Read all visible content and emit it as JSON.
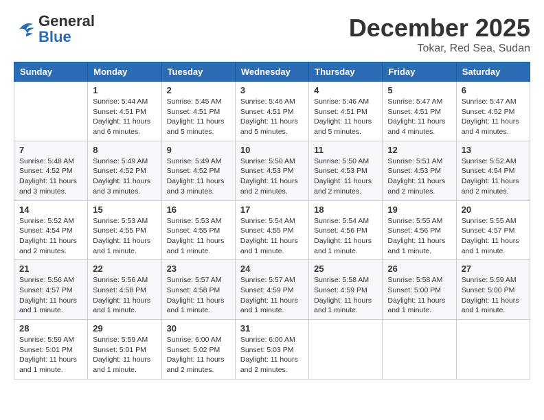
{
  "header": {
    "logo_general": "General",
    "logo_blue": "Blue",
    "month": "December 2025",
    "location": "Tokar, Red Sea, Sudan"
  },
  "days_of_week": [
    "Sunday",
    "Monday",
    "Tuesday",
    "Wednesday",
    "Thursday",
    "Friday",
    "Saturday"
  ],
  "weeks": [
    [
      {
        "day": null,
        "info": ""
      },
      {
        "day": "1",
        "sunrise": "5:44 AM",
        "sunset": "4:51 PM",
        "daylight": "11 hours and 6 minutes."
      },
      {
        "day": "2",
        "sunrise": "5:45 AM",
        "sunset": "4:51 PM",
        "daylight": "11 hours and 5 minutes."
      },
      {
        "day": "3",
        "sunrise": "5:46 AM",
        "sunset": "4:51 PM",
        "daylight": "11 hours and 5 minutes."
      },
      {
        "day": "4",
        "sunrise": "5:46 AM",
        "sunset": "4:51 PM",
        "daylight": "11 hours and 5 minutes."
      },
      {
        "day": "5",
        "sunrise": "5:47 AM",
        "sunset": "4:51 PM",
        "daylight": "11 hours and 4 minutes."
      },
      {
        "day": "6",
        "sunrise": "5:47 AM",
        "sunset": "4:52 PM",
        "daylight": "11 hours and 4 minutes."
      }
    ],
    [
      {
        "day": "7",
        "sunrise": "5:48 AM",
        "sunset": "4:52 PM",
        "daylight": "11 hours and 3 minutes."
      },
      {
        "day": "8",
        "sunrise": "5:49 AM",
        "sunset": "4:52 PM",
        "daylight": "11 hours and 3 minutes."
      },
      {
        "day": "9",
        "sunrise": "5:49 AM",
        "sunset": "4:52 PM",
        "daylight": "11 hours and 3 minutes."
      },
      {
        "day": "10",
        "sunrise": "5:50 AM",
        "sunset": "4:53 PM",
        "daylight": "11 hours and 2 minutes."
      },
      {
        "day": "11",
        "sunrise": "5:50 AM",
        "sunset": "4:53 PM",
        "daylight": "11 hours and 2 minutes."
      },
      {
        "day": "12",
        "sunrise": "5:51 AM",
        "sunset": "4:53 PM",
        "daylight": "11 hours and 2 minutes."
      },
      {
        "day": "13",
        "sunrise": "5:52 AM",
        "sunset": "4:54 PM",
        "daylight": "11 hours and 2 minutes."
      }
    ],
    [
      {
        "day": "14",
        "sunrise": "5:52 AM",
        "sunset": "4:54 PM",
        "daylight": "11 hours and 2 minutes."
      },
      {
        "day": "15",
        "sunrise": "5:53 AM",
        "sunset": "4:55 PM",
        "daylight": "11 hours and 1 minute."
      },
      {
        "day": "16",
        "sunrise": "5:53 AM",
        "sunset": "4:55 PM",
        "daylight": "11 hours and 1 minute."
      },
      {
        "day": "17",
        "sunrise": "5:54 AM",
        "sunset": "4:55 PM",
        "daylight": "11 hours and 1 minute."
      },
      {
        "day": "18",
        "sunrise": "5:54 AM",
        "sunset": "4:56 PM",
        "daylight": "11 hours and 1 minute."
      },
      {
        "day": "19",
        "sunrise": "5:55 AM",
        "sunset": "4:56 PM",
        "daylight": "11 hours and 1 minute."
      },
      {
        "day": "20",
        "sunrise": "5:55 AM",
        "sunset": "4:57 PM",
        "daylight": "11 hours and 1 minute."
      }
    ],
    [
      {
        "day": "21",
        "sunrise": "5:56 AM",
        "sunset": "4:57 PM",
        "daylight": "11 hours and 1 minute."
      },
      {
        "day": "22",
        "sunrise": "5:56 AM",
        "sunset": "4:58 PM",
        "daylight": "11 hours and 1 minute."
      },
      {
        "day": "23",
        "sunrise": "5:57 AM",
        "sunset": "4:58 PM",
        "daylight": "11 hours and 1 minute."
      },
      {
        "day": "24",
        "sunrise": "5:57 AM",
        "sunset": "4:59 PM",
        "daylight": "11 hours and 1 minute."
      },
      {
        "day": "25",
        "sunrise": "5:58 AM",
        "sunset": "4:59 PM",
        "daylight": "11 hours and 1 minute."
      },
      {
        "day": "26",
        "sunrise": "5:58 AM",
        "sunset": "5:00 PM",
        "daylight": "11 hours and 1 minute."
      },
      {
        "day": "27",
        "sunrise": "5:59 AM",
        "sunset": "5:00 PM",
        "daylight": "11 hours and 1 minute."
      }
    ],
    [
      {
        "day": "28",
        "sunrise": "5:59 AM",
        "sunset": "5:01 PM",
        "daylight": "11 hours and 1 minute."
      },
      {
        "day": "29",
        "sunrise": "5:59 AM",
        "sunset": "5:01 PM",
        "daylight": "11 hours and 1 minute."
      },
      {
        "day": "30",
        "sunrise": "6:00 AM",
        "sunset": "5:02 PM",
        "daylight": "11 hours and 2 minutes."
      },
      {
        "day": "31",
        "sunrise": "6:00 AM",
        "sunset": "5:03 PM",
        "daylight": "11 hours and 2 minutes."
      },
      {
        "day": null,
        "info": ""
      },
      {
        "day": null,
        "info": ""
      },
      {
        "day": null,
        "info": ""
      }
    ]
  ],
  "labels": {
    "sunrise": "Sunrise:",
    "sunset": "Sunset:",
    "daylight": "Daylight:"
  }
}
